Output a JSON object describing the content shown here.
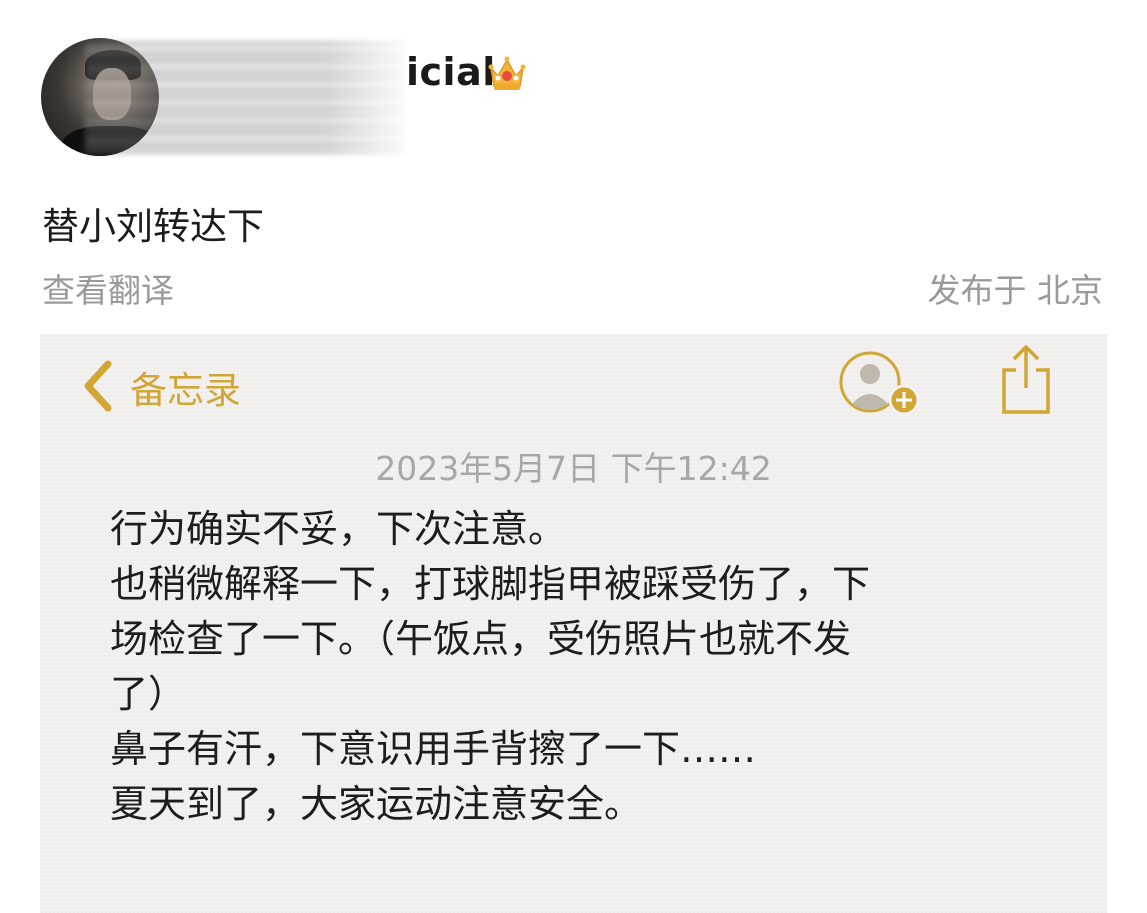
{
  "post": {
    "username_visible": "icial",
    "badge_icon": "crown-icon",
    "text": "替小刘转达下",
    "translate_link": "查看翻译",
    "location": "发布于 北京"
  },
  "note": {
    "back_label": "备忘录",
    "timestamp": "2023年5月7日 下午12:42",
    "lines": [
      "行为确实不妥，下次注意。",
      "也稍微解释一下，打球脚指甲被踩受伤了，下",
      "场检查了一下。（午饭点，受伤照片也就不发",
      "了）",
      "鼻子有汗，下意识用手背擦了一下……",
      "夏天到了，大家运动注意安全。"
    ],
    "icons": [
      "chevron-left-icon",
      "add-person-icon",
      "share-icon"
    ]
  },
  "colors": {
    "accent_gold": "#d1a634",
    "muted_gray": "#9a9a9a",
    "note_bg": "#f2f1ef"
  }
}
